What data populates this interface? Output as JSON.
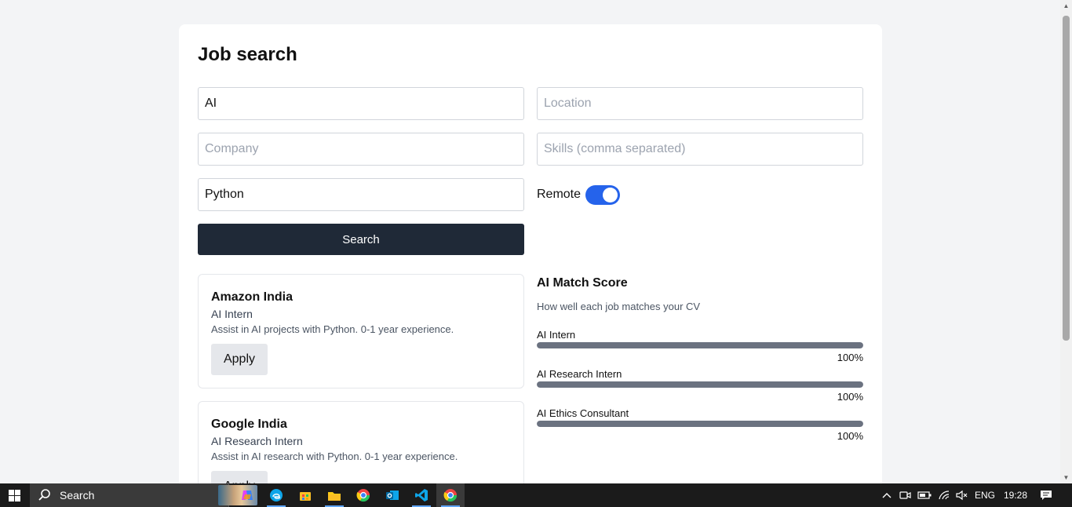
{
  "page": {
    "title": "Job search"
  },
  "form": {
    "keyword": {
      "value": "AI",
      "placeholder": ""
    },
    "location": {
      "value": "",
      "placeholder": "Location"
    },
    "company": {
      "value": "",
      "placeholder": "Company"
    },
    "skills": {
      "value": "",
      "placeholder": "Skills (comma separated)"
    },
    "tech": {
      "value": "Python",
      "placeholder": ""
    },
    "remote_label": "Remote",
    "remote_on": true,
    "search_label": "Search"
  },
  "jobs": [
    {
      "company": "Amazon India",
      "role": "AI Intern",
      "description": "Assist in AI projects with Python. 0-1 year experience.",
      "apply_label": "Apply"
    },
    {
      "company": "Google India",
      "role": "AI Research Intern",
      "description": "Assist in AI research with Python. 0-1 year experience.",
      "apply_label": "Apply"
    }
  ],
  "match": {
    "title": "AI Match Score",
    "subtitle": "How well each job matches your CV",
    "rows": [
      {
        "label": "AI Intern",
        "percent_text": "100%",
        "percent": 100
      },
      {
        "label": "AI Research Intern",
        "percent_text": "100%",
        "percent": 100
      },
      {
        "label": "AI Ethics Consultant",
        "percent_text": "100%",
        "percent": 100
      }
    ]
  },
  "colors": {
    "toggle_on": "#2563eb",
    "search_button": "#1f2937",
    "bar_fill": "#6b7280"
  },
  "taskbar": {
    "search_text": "Search",
    "apps": [
      "copilot-icon",
      "edge-icon",
      "store-icon",
      "file-explorer-icon",
      "chrome-icon",
      "outlook-icon",
      "vscode-icon",
      "chrome-active-icon"
    ],
    "language": "ENG",
    "time": "19:28"
  }
}
